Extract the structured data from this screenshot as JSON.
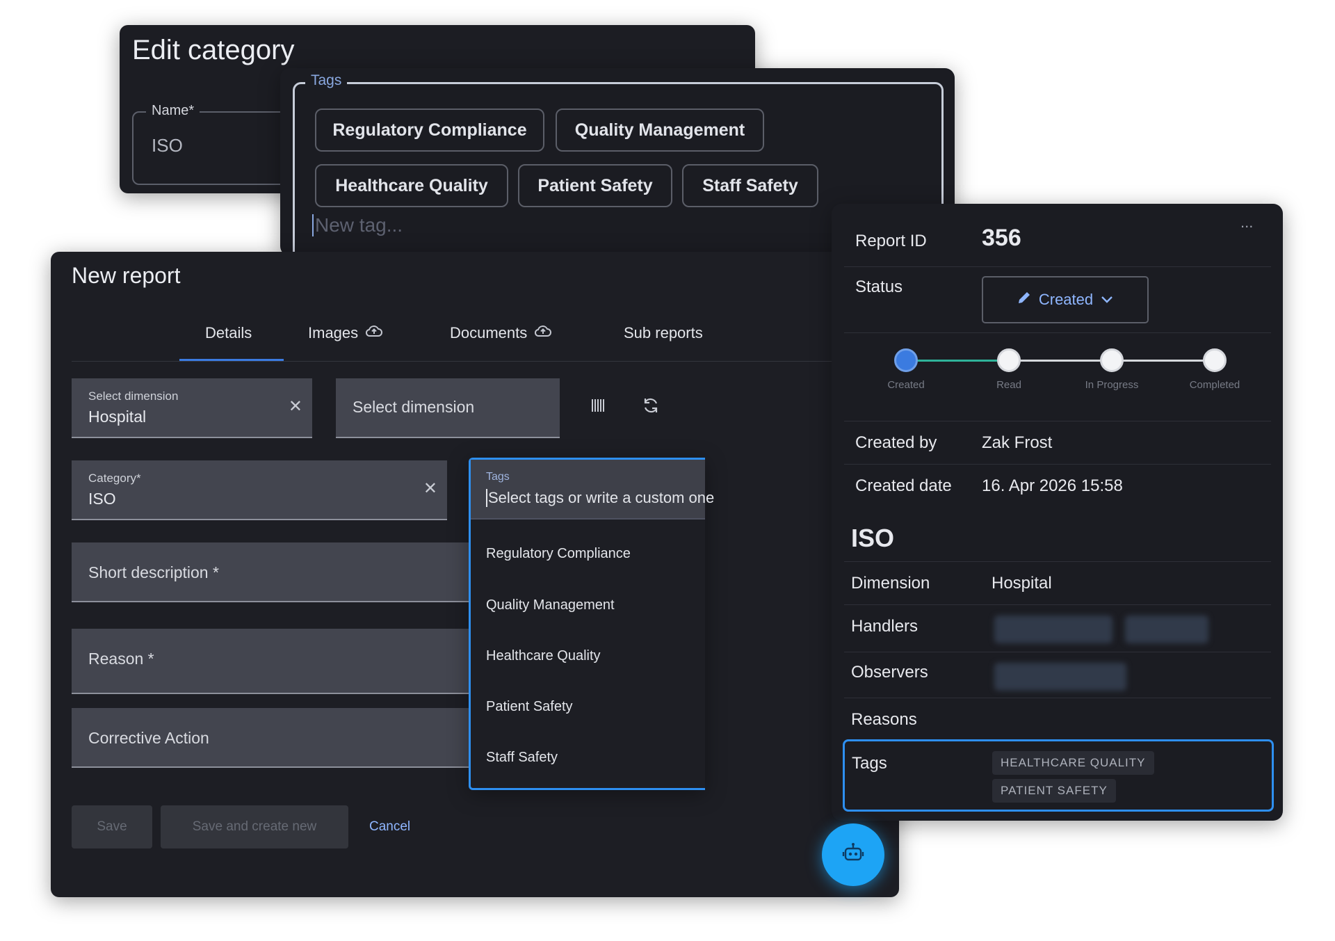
{
  "edit_category": {
    "title": "Edit category",
    "name_label": "Name*",
    "name_value": "ISO"
  },
  "tags_editor": {
    "legend": "Tags",
    "chips": [
      "Regulatory Compliance",
      "Quality Management",
      "Healthcare Quality",
      "Patient Safety",
      "Staff Safety"
    ],
    "new_tag_placeholder": "New tag..."
  },
  "new_report": {
    "title": "New report",
    "tabs": [
      {
        "label": "Details",
        "icon": "none"
      },
      {
        "label": "Images",
        "icon": "cloud-upload-icon"
      },
      {
        "label": "Documents",
        "icon": "cloud-upload-icon"
      },
      {
        "label": "Sub reports",
        "icon": "none"
      }
    ],
    "dimension_field": {
      "label": "Select dimension",
      "value": "Hospital"
    },
    "dimension_field_2": {
      "placeholder": "Select dimension"
    },
    "category_field": {
      "label": "Category*",
      "value": "ISO"
    },
    "short_description": "Short description *",
    "reason": "Reason *",
    "corrective_action": "Corrective Action",
    "buttons": {
      "save": "Save",
      "save_and_new": "Save and create new",
      "cancel": "Cancel"
    }
  },
  "tags_dropdown": {
    "label": "Tags",
    "placeholder": "Select tags or write a custom one",
    "options": [
      "Regulatory Compliance",
      "Quality Management",
      "Healthcare Quality",
      "Patient Safety",
      "Staff Safety"
    ]
  },
  "report_detail": {
    "report_id_label": "Report ID",
    "report_id": "356",
    "more": "...",
    "status_label": "Status",
    "status_value": "Created",
    "steps": [
      "Created",
      "Read",
      "In Progress",
      "Completed"
    ],
    "active_step": 0,
    "created_by_label": "Created by",
    "created_by": "Zak Frost",
    "created_date_label": "Created date",
    "created_date": "16. Apr 2026 15:58",
    "category": "ISO",
    "dimension_label": "Dimension",
    "dimension": "Hospital",
    "handlers_label": "Handlers",
    "observers_label": "Observers",
    "reasons_label": "Reasons",
    "tags_label": "Tags",
    "tags": [
      "HEALTHCARE QUALITY",
      "PATIENT SAFETY"
    ]
  },
  "colors": {
    "accent": "#2e8ff0",
    "step_active": "#3b7be0",
    "step_line_done": "#2fb39a",
    "assistant": "#1da4f5"
  }
}
